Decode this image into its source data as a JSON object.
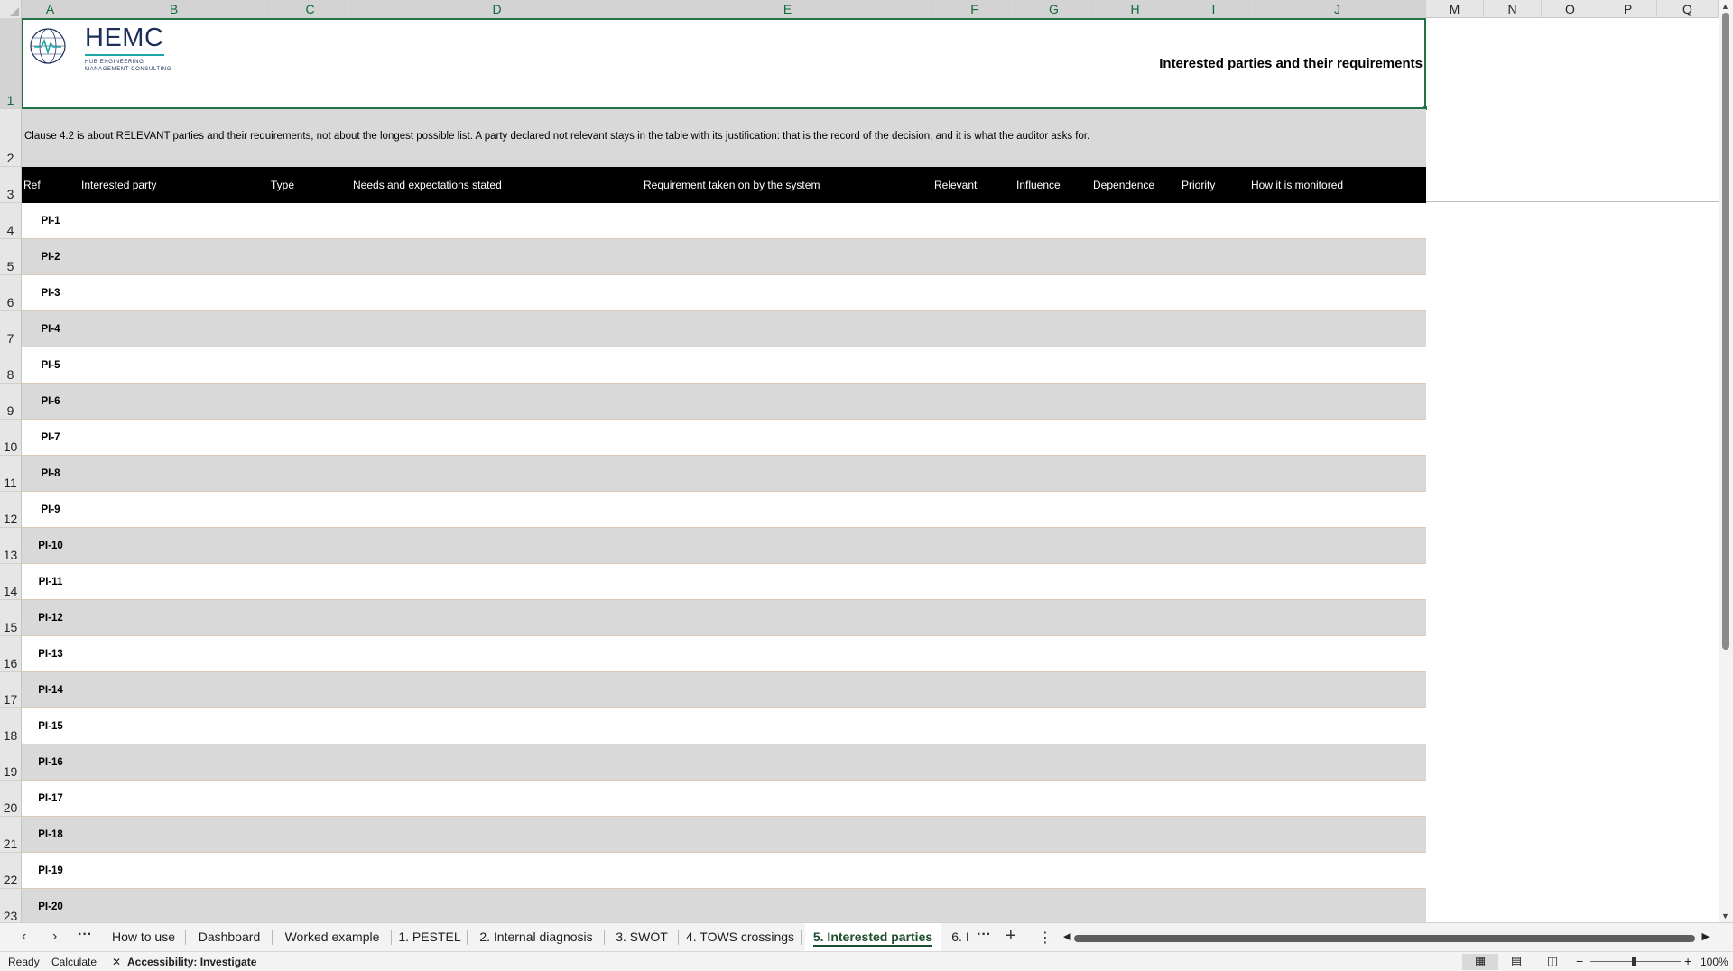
{
  "columns": [
    "A",
    "B",
    "C",
    "D",
    "E",
    "F",
    "G",
    "H",
    "I",
    "J",
    "M",
    "N",
    "O",
    "P",
    "Q"
  ],
  "rows": [
    "1",
    "2",
    "3",
    "4",
    "5",
    "6",
    "7",
    "8",
    "9",
    "10",
    "11",
    "12",
    "13",
    "14",
    "15",
    "16",
    "17",
    "18",
    "19",
    "20",
    "21",
    "22",
    "23"
  ],
  "header": {
    "brand": "HEMC",
    "brand_sub_1": "HUB ENGINEERING",
    "brand_sub_2": "MANAGEMENT CONSULTING",
    "page_title": "Interested parties and their requirements"
  },
  "note": "Clause 4.2 is about RELEVANT parties and their requirements, not about the longest possible list. A party declared not relevant stays in the table with its justification: that is the record of the decision, and it is what the auditor asks for.",
  "table": {
    "headers": [
      "Ref",
      "Interested party",
      "Type",
      "Needs and expectations stated",
      "Requirement taken on by the system",
      "Relevant",
      "Influence",
      "Dependence",
      "Priority",
      "How it is monitored"
    ],
    "refs": [
      "PI-1",
      "PI-2",
      "PI-3",
      "PI-4",
      "PI-5",
      "PI-6",
      "PI-7",
      "PI-8",
      "PI-9",
      "PI-10",
      "PI-11",
      "PI-12",
      "PI-13",
      "PI-14",
      "PI-15",
      "PI-16",
      "PI-17",
      "PI-18",
      "PI-19",
      "PI-20"
    ]
  },
  "sheet_tabs": [
    "How to use",
    "Dashboard",
    "Worked example",
    "1. PESTEL",
    "2. Internal diagnosis",
    "3. SWOT",
    "4. TOWS crossings",
    "5. Interested parties",
    "6. I"
  ],
  "active_tab": "5. Interested parties",
  "status": {
    "ready": "Ready",
    "calculate": "Calculate",
    "accessibility": "Accessibility: Investigate",
    "zoom": "100%"
  },
  "colors": {
    "accent": "#217346",
    "header_bg": "#000000",
    "band_bg": "#d9d9d9",
    "brand": "#1b2f5a"
  },
  "icons": [
    "globe-logo-icon",
    "prev-sheet-icon",
    "next-sheet-icon",
    "more-sheets-icon",
    "add-sheet-icon",
    "options-icon",
    "normal-view-icon",
    "page-layout-icon",
    "page-break-icon",
    "accessibility-icon"
  ]
}
